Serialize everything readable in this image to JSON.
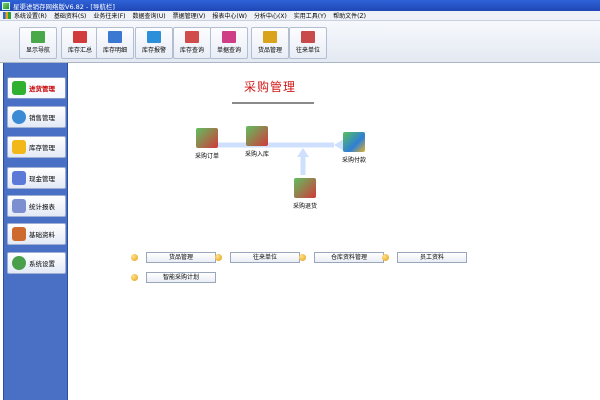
{
  "window": {
    "title": "星渠进销存网络版V6.82 - [导航栏]"
  },
  "menu": [
    "系统设置(R)",
    "基础资料(S)",
    "业务往来(F)",
    "数据查询(U)",
    "票据管理(V)",
    "报表中心(W)",
    "分析中心(X)",
    "实用工具(Y)",
    "帮助文件(Z)"
  ],
  "toolbar": [
    {
      "label": "显示导航",
      "icon": "map-icon",
      "color": "#49a84a"
    },
    {
      "label": "库存汇总",
      "icon": "summary-icon",
      "color": "#d23b3b"
    },
    {
      "label": "库存明细",
      "icon": "detail-icon",
      "color": "#3b78d2"
    },
    {
      "label": "库存报警",
      "icon": "alarm-icon",
      "color": "#2b8fd9"
    },
    {
      "label": "库存查询",
      "icon": "query-icon",
      "color": "#d24b4b"
    },
    {
      "label": "单据查询",
      "icon": "document-icon",
      "color": "#cf3d86"
    },
    {
      "label": "货品管理",
      "icon": "goods-icon",
      "color": "#d9a31b"
    },
    {
      "label": "往来单位",
      "icon": "partner-icon",
      "color": "#c94a4a"
    }
  ],
  "sidebar": [
    {
      "label": "进货管理",
      "icon": "plus-icon",
      "color": "#2fb02f",
      "active": true
    },
    {
      "label": "销售管理",
      "icon": "globe-icon",
      "color": "#3a8ad6"
    },
    {
      "label": "库存管理",
      "icon": "star-icon",
      "color": "#f2b81a"
    },
    {
      "label": "现金管理",
      "icon": "cash-icon",
      "color": "#5b79d6"
    },
    {
      "label": "统计报表",
      "icon": "report-icon",
      "color": "#7c8fd0"
    },
    {
      "label": "基础资料",
      "icon": "tools-icon",
      "color": "#cf6a2e"
    },
    {
      "label": "系统设置",
      "icon": "gear-icon",
      "color": "#4aa04a"
    }
  ],
  "main": {
    "title": "采购管理",
    "flow": {
      "order": "采购订单",
      "inbound": "采购入库",
      "payment": "采购付款",
      "return": "采购退货"
    },
    "modules": [
      "货品管理",
      "往来单位",
      "仓库资料管理",
      "员工资料",
      "智能采购计划"
    ]
  },
  "colors": {
    "accent_red": "#d01818",
    "sidebar_blue": "#4a70c6",
    "arrow": "#cfe0ff"
  }
}
